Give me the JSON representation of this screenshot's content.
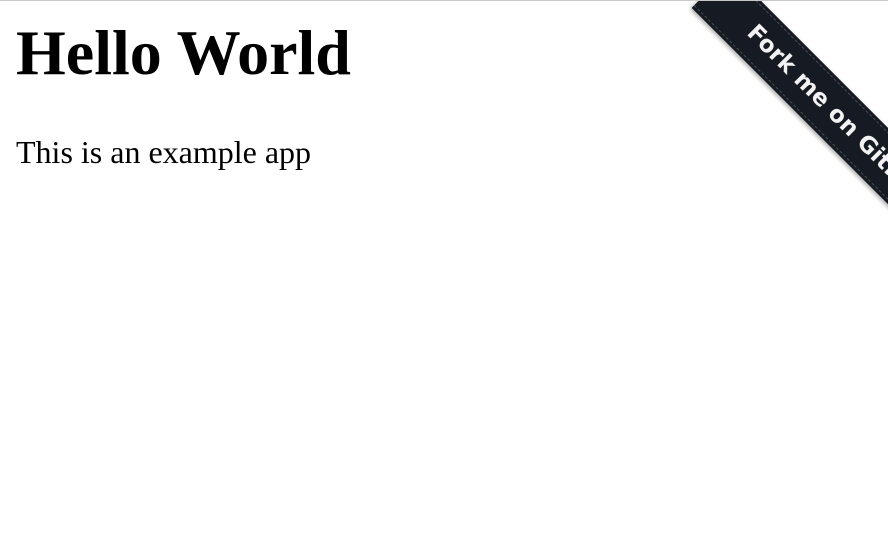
{
  "main": {
    "title": "Hello World",
    "subtitle": "This is an example app"
  },
  "ribbon": {
    "label": "Fork me on GitHub",
    "background_color": "#151a23",
    "text_color": "#f2f2f2"
  }
}
